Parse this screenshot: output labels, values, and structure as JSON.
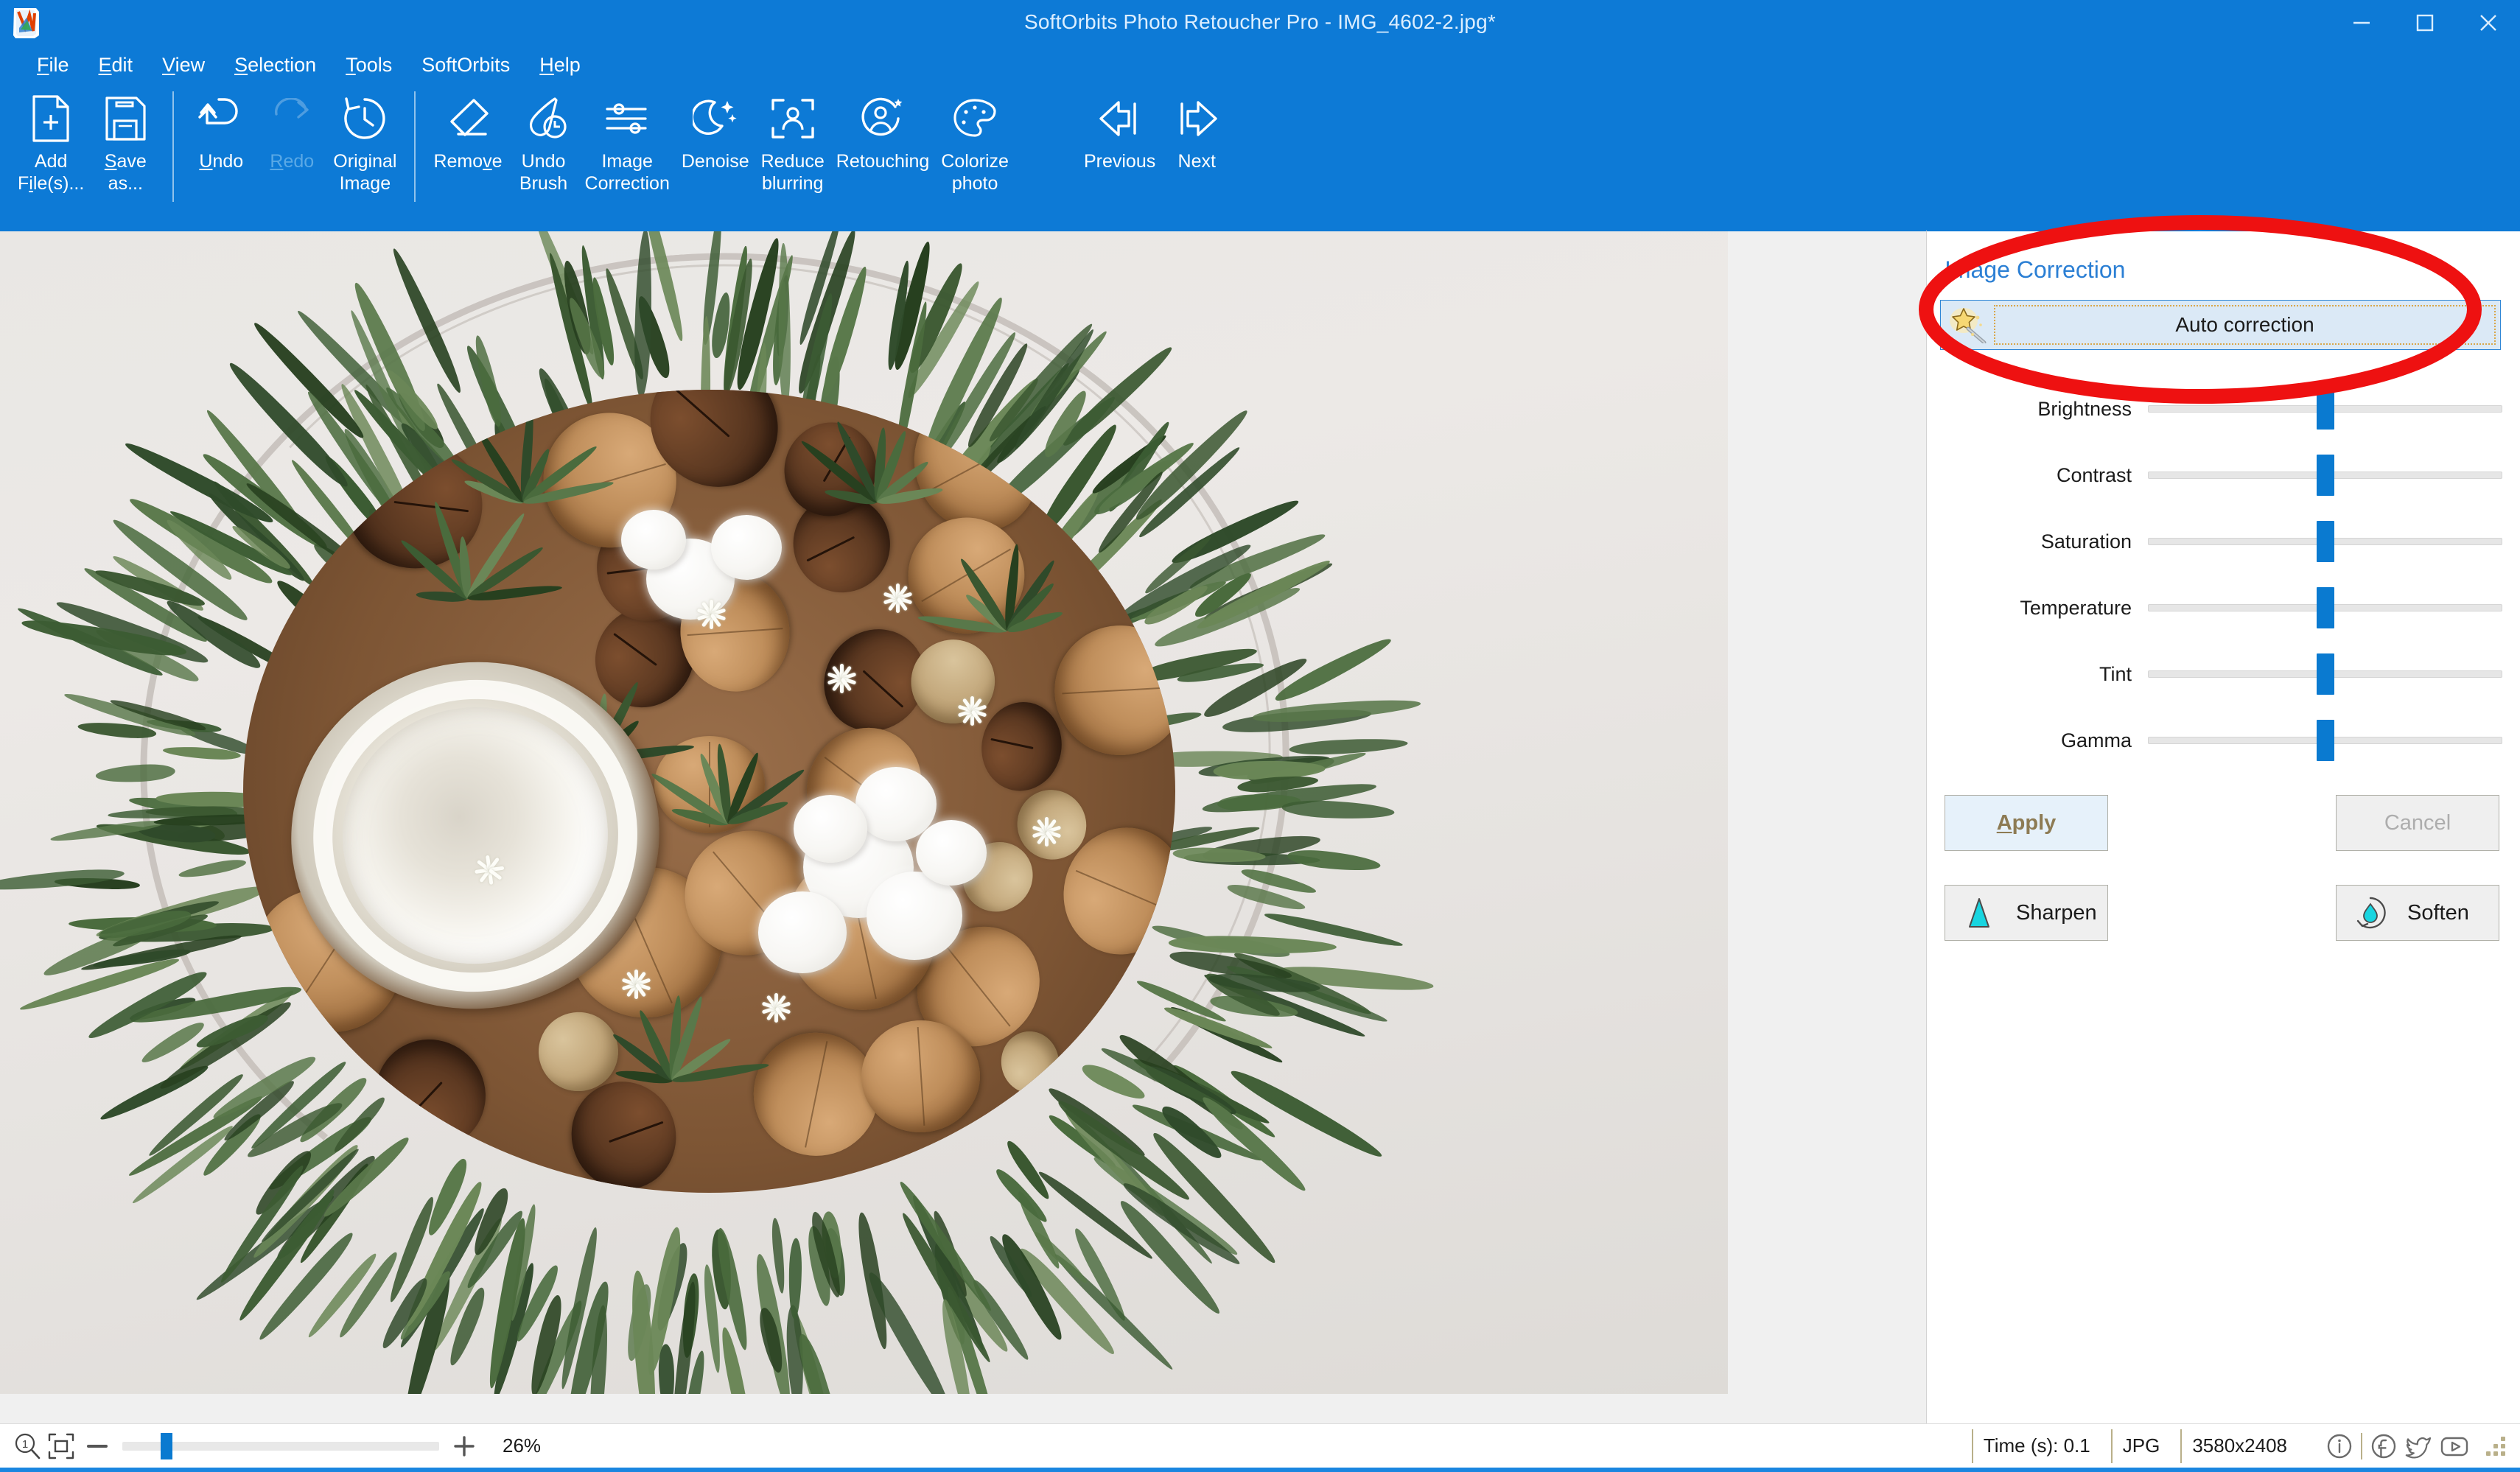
{
  "window": {
    "title": "SoftOrbits Photo Retoucher Pro - IMG_4602-2.jpg*",
    "minimize_label": "Minimize",
    "maximize_label": "Maximize",
    "close_label": "Close",
    "accent_color": "#0d7ad6"
  },
  "menubar": {
    "items": [
      {
        "label": "File",
        "mnemonic": "F"
      },
      {
        "label": "Edit",
        "mnemonic": "E"
      },
      {
        "label": "View",
        "mnemonic": "V"
      },
      {
        "label": "Selection",
        "mnemonic": "S"
      },
      {
        "label": "Tools",
        "mnemonic": "T"
      },
      {
        "label": "SoftOrbits",
        "mnemonic": ""
      },
      {
        "label": "Help",
        "mnemonic": "H"
      }
    ]
  },
  "toolbar": {
    "buttons": [
      {
        "id": "add-files",
        "label": "Add\nFile(s)...",
        "icon": "document-plus-icon",
        "enabled": true
      },
      {
        "id": "save-as",
        "label": "Save\nas...",
        "icon": "floppy-disk-icon",
        "enabled": true
      },
      {
        "id": "undo",
        "label": "Undo",
        "icon": "undo-arrow-icon",
        "enabled": true
      },
      {
        "id": "redo",
        "label": "Redo",
        "icon": "redo-arrow-icon",
        "enabled": false
      },
      {
        "id": "original-image",
        "label": "Original\nImage",
        "icon": "history-clock-icon",
        "enabled": true
      },
      {
        "id": "remove",
        "label": "Remove",
        "icon": "eraser-icon",
        "enabled": true
      },
      {
        "id": "undo-brush",
        "label": "Undo\nBrush",
        "icon": "brush-clock-icon",
        "enabled": true
      },
      {
        "id": "image-correction",
        "label": "Image\nCorrection",
        "icon": "sliders-icon",
        "enabled": true
      },
      {
        "id": "denoise",
        "label": "Denoise",
        "icon": "moon-stars-icon",
        "enabled": true
      },
      {
        "id": "reduce-blurring",
        "label": "Reduce\nblurring",
        "icon": "portrait-focus-icon",
        "enabled": true
      },
      {
        "id": "retouching",
        "label": "Retouching",
        "icon": "person-gear-icon",
        "enabled": true
      },
      {
        "id": "colorize-photo",
        "label": "Colorize\nphoto",
        "icon": "palette-icon",
        "enabled": true
      },
      {
        "id": "previous",
        "label": "Previous",
        "icon": "arrow-left-icon",
        "enabled": true
      },
      {
        "id": "next",
        "label": "Next",
        "icon": "arrow-right-icon",
        "enabled": true
      }
    ]
  },
  "panel": {
    "title": "Image Correction",
    "auto_correction": {
      "label": "Auto correction",
      "icon": "magic-wand-icon",
      "focused": true
    },
    "sliders": [
      {
        "name": "Brightness",
        "value": 50
      },
      {
        "name": "Contrast",
        "value": 50
      },
      {
        "name": "Saturation",
        "value": 50
      },
      {
        "name": "Temperature",
        "value": 50
      },
      {
        "name": "Tint",
        "value": 50
      },
      {
        "name": "Gamma",
        "value": 50
      }
    ],
    "apply_label": "Apply",
    "apply_mnemonic": "A",
    "cancel_label": "Cancel",
    "cancel_enabled": false,
    "sharpen_label": "Sharpen",
    "sharpen_icon": "sharpen-triangle-icon",
    "soften_label": "Soften",
    "soften_icon": "soften-droplet-icon",
    "accent_color": "#2b7fd4",
    "slider_thumb_color": "#0a7ad0"
  },
  "statusbar": {
    "zoom_icon": "zoom-actual-size-icon",
    "fit_icon": "fit-to-window-icon",
    "minus_label": "−",
    "plus_label": "+",
    "zoom_percent": "26%",
    "zoom_value": 12,
    "time_label": "Time (s): 0.1",
    "format_label": "JPG",
    "dimensions_label": "3580x2408",
    "social": [
      {
        "id": "about",
        "icon": "info-circle-icon"
      },
      {
        "id": "facebook",
        "icon": "facebook-icon"
      },
      {
        "id": "twitter",
        "icon": "twitter-bird-icon"
      },
      {
        "id": "youtube",
        "icon": "youtube-play-icon"
      }
    ]
  },
  "annotation": {
    "shape": "ellipse",
    "color": "#ee1111",
    "target": "auto-correction-button"
  },
  "photo": {
    "description": "Top-down photo of a decorative arrangement of walnuts, macadamia nuts, hazelnuts, cotton bolls and small white flowers with rosemary sprigs around a halved coconut, on a white background with a thin wire hoop."
  }
}
